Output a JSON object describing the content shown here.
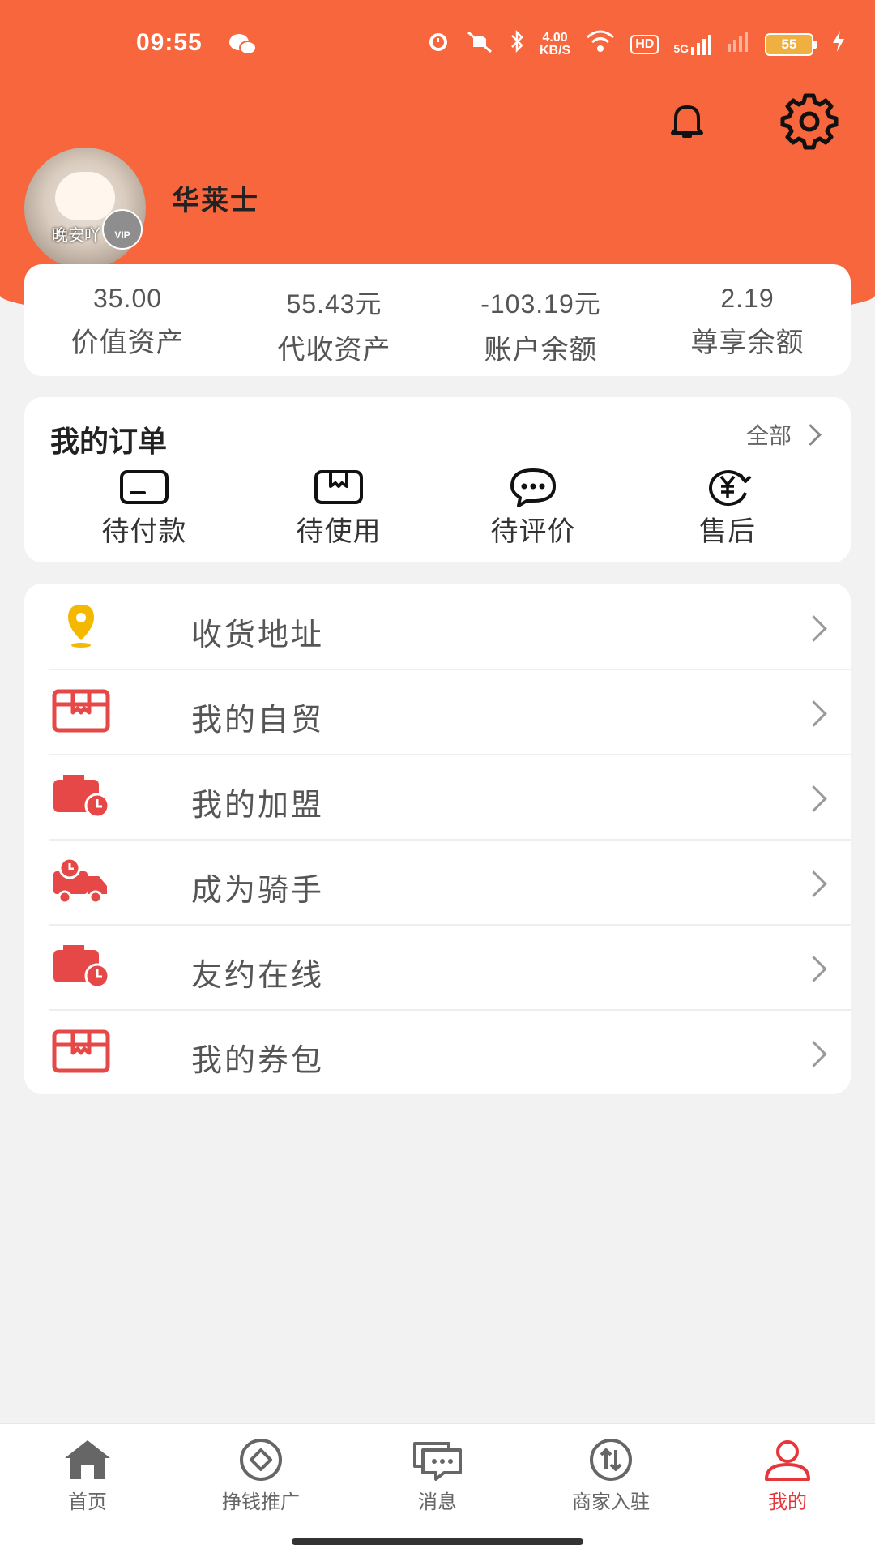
{
  "status_bar": {
    "time": "09:55",
    "net_speed_value": "4.00",
    "net_speed_unit": "KB/S",
    "hd_label": "HD",
    "signal_label": "5G",
    "battery": "55"
  },
  "profile": {
    "name": "华莱士",
    "avatar_caption": "晚安吖",
    "vip_label": "VIP"
  },
  "assets": [
    {
      "value": "35.00",
      "label": "价值资产"
    },
    {
      "value": "55.43元",
      "label": "代收资产"
    },
    {
      "value": "-103.19元",
      "label": "账户余额"
    },
    {
      "value": "2.19",
      "label": "尊享余额"
    }
  ],
  "orders": {
    "title": "我的订单",
    "all_label": "全部",
    "items": [
      {
        "label": "待付款",
        "icon": "wallet-icon"
      },
      {
        "label": "待使用",
        "icon": "box-icon"
      },
      {
        "label": "待评价",
        "icon": "chat-bubble-icon"
      },
      {
        "label": "售后",
        "icon": "yuan-refund-icon"
      }
    ]
  },
  "menu": [
    {
      "label": "收货地址",
      "icon": "location-pin-icon"
    },
    {
      "label": "我的自贸",
      "icon": "box-icon"
    },
    {
      "label": "我的加盟",
      "icon": "wallet-clock-icon"
    },
    {
      "label": "成为骑手",
      "icon": "delivery-truck-icon"
    },
    {
      "label": "友约在线",
      "icon": "wallet-clock-icon"
    },
    {
      "label": "我的券包",
      "icon": "box-icon"
    }
  ],
  "bottom_nav": [
    {
      "label": "首页",
      "icon": "home-icon",
      "active": false
    },
    {
      "label": "挣钱推广",
      "icon": "diamond-icon",
      "active": false
    },
    {
      "label": "消息",
      "icon": "message-icon",
      "active": false
    },
    {
      "label": "商家入驻",
      "icon": "merchant-icon",
      "active": false
    },
    {
      "label": "我的",
      "icon": "user-icon",
      "active": true
    }
  ],
  "colors": {
    "header": "#f7663d",
    "accent_red": "#e8353a",
    "pin_yellow": "#f5b800",
    "background": "#f2f2f2"
  }
}
